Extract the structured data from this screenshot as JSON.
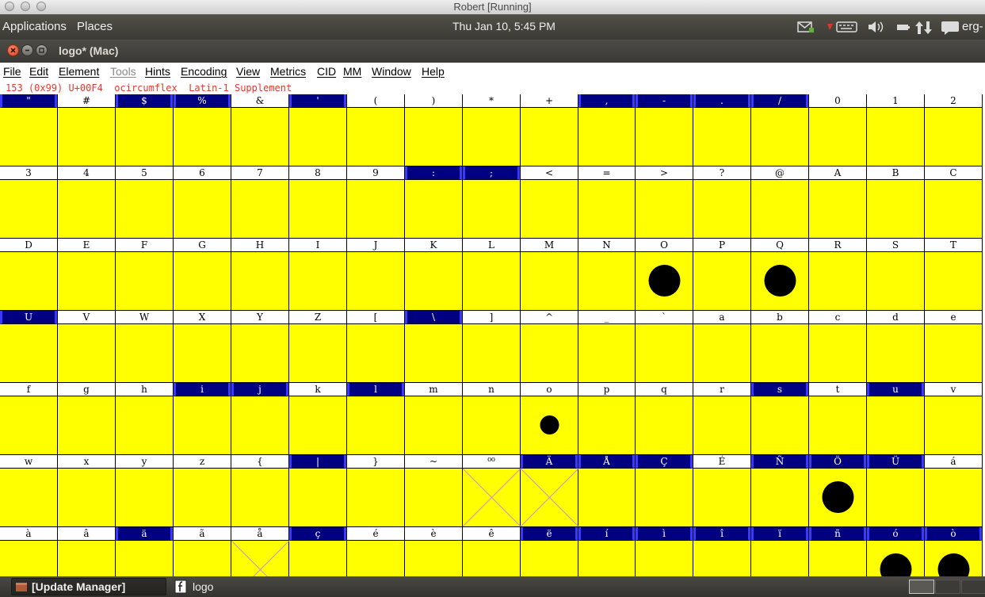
{
  "vm_window": {
    "title": "Robert [Running]"
  },
  "top_panel": {
    "menus": [
      "Applications",
      "Places"
    ],
    "clock": "Thu Jan 10,  5:45 PM",
    "user": "erg-"
  },
  "window": {
    "title": "logo*  (Mac)"
  },
  "menubar": [
    "File",
    "Edit",
    "Element",
    "Tools",
    "Hints",
    "Encoding",
    "View",
    "Metrics",
    "CID",
    "MM",
    "Window",
    "Help"
  ],
  "menubar_disabled": [
    "Tools"
  ],
  "info_line": "153 (0x99) U+00F4  ocircumflex  Latin-1 Supplement",
  "glyph_grid": {
    "columns": 17,
    "colors": {
      "cell_fill": "#ffff00",
      "selected_label": "#000080",
      "empty_mark": "#d28ad8"
    },
    "rows": [
      [
        "\"",
        "#",
        "$",
        "%",
        "&",
        "'",
        "(",
        ")",
        "*",
        "+",
        ",",
        "-",
        ".",
        "/",
        "0",
        "1",
        "2"
      ],
      [
        "3",
        "4",
        "5",
        "6",
        "7",
        "8",
        "9",
        ":",
        ";",
        "<",
        "=",
        ">",
        "?",
        "@",
        "A",
        "B",
        "C"
      ],
      [
        "D",
        "E",
        "F",
        "G",
        "H",
        "I",
        "J",
        "K",
        "L",
        "M",
        "N",
        "O",
        "P",
        "Q",
        "R",
        "S",
        "T"
      ],
      [
        "U",
        "V",
        "W",
        "X",
        "Y",
        "Z",
        "[",
        "\\",
        "]",
        "^",
        "_",
        "`",
        "a",
        "b",
        "c",
        "d",
        "e"
      ],
      [
        "f",
        "g",
        "h",
        "i",
        "j",
        "k",
        "l",
        "m",
        "n",
        "o",
        "p",
        "q",
        "r",
        "s",
        "t",
        "u",
        "v"
      ],
      [
        "w",
        "x",
        "y",
        "z",
        "{",
        "|",
        "}",
        "~",
        "⁰⁰",
        "Ä",
        "Å",
        "Ç",
        "É",
        "Ñ",
        "Ö",
        "Ü",
        "á"
      ],
      [
        "à",
        "â",
        "ä",
        "ã",
        "å",
        "ç",
        "é",
        "è",
        "ê",
        "ë",
        "í",
        "ì",
        "î",
        "ï",
        "ñ",
        "ó",
        "ò"
      ]
    ],
    "selected": [
      "\"",
      "$",
      "%",
      "'",
      ",",
      "-",
      ".",
      "/",
      ":",
      ";",
      "U",
      "\\",
      "i",
      "j",
      "l",
      "s",
      "u",
      "|",
      "Ä",
      "Å",
      "Ç",
      "Ñ",
      "Ö",
      "Ü",
      "ä",
      "ç",
      "ë",
      "í",
      "ì",
      "î",
      "ï",
      "ñ",
      "ó",
      "ò"
    ],
    "glyphs": {
      "O": "dot-large",
      "Q": "dot-large",
      "o": "dot-small",
      "Ö": "dot-large",
      "ó": "dot-large",
      "ò": "dot-large",
      "⁰⁰": "empty-cross",
      "Ä": "empty-cross",
      "å": "empty-cross"
    }
  },
  "taskbar": {
    "tasks": [
      {
        "label": "[Update Manager]",
        "icon": "package-icon",
        "active": true
      },
      {
        "label": "logo",
        "icon": "fontforge-icon",
        "active": false
      }
    ]
  }
}
